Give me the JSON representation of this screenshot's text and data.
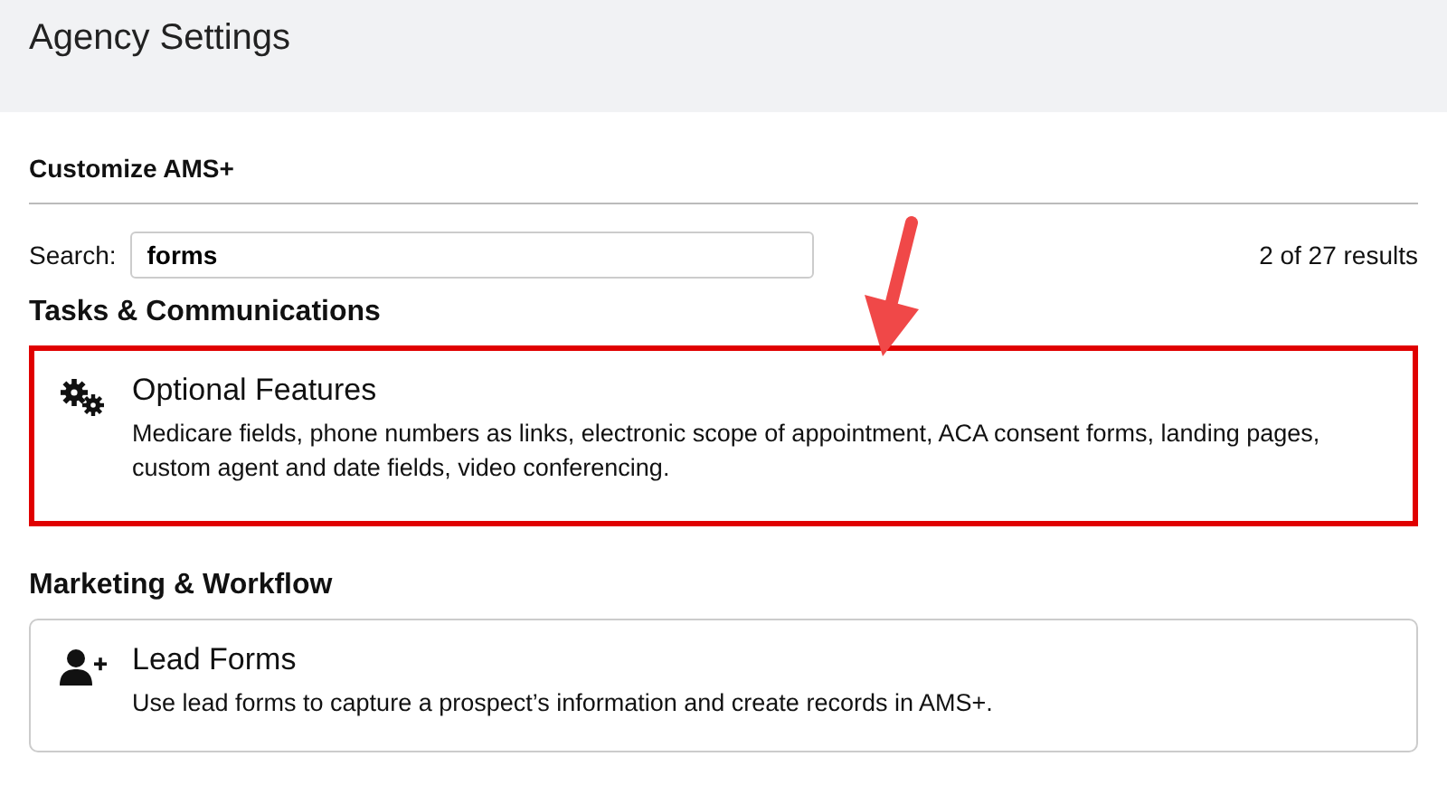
{
  "header": {
    "title": "Agency Settings"
  },
  "section_title": "Customize AMS+",
  "search": {
    "label": "Search:",
    "value": "forms",
    "results": "2 of 27 results"
  },
  "groups": [
    {
      "heading": "Tasks & Communications",
      "cards": [
        {
          "kind": "gears",
          "title": "Optional Features",
          "description": "Medicare fields, phone numbers as links, electronic scope of appointment, ACA consent forms, landing pages, custom agent and date fields, video conferencing.",
          "highlighted": true
        }
      ]
    },
    {
      "heading": "Marketing & Workflow",
      "cards": [
        {
          "kind": "user-plus",
          "title": "Lead Forms",
          "description": "Use lead forms to capture a prospect’s information and create records in AMS+.",
          "highlighted": false
        }
      ]
    }
  ]
}
